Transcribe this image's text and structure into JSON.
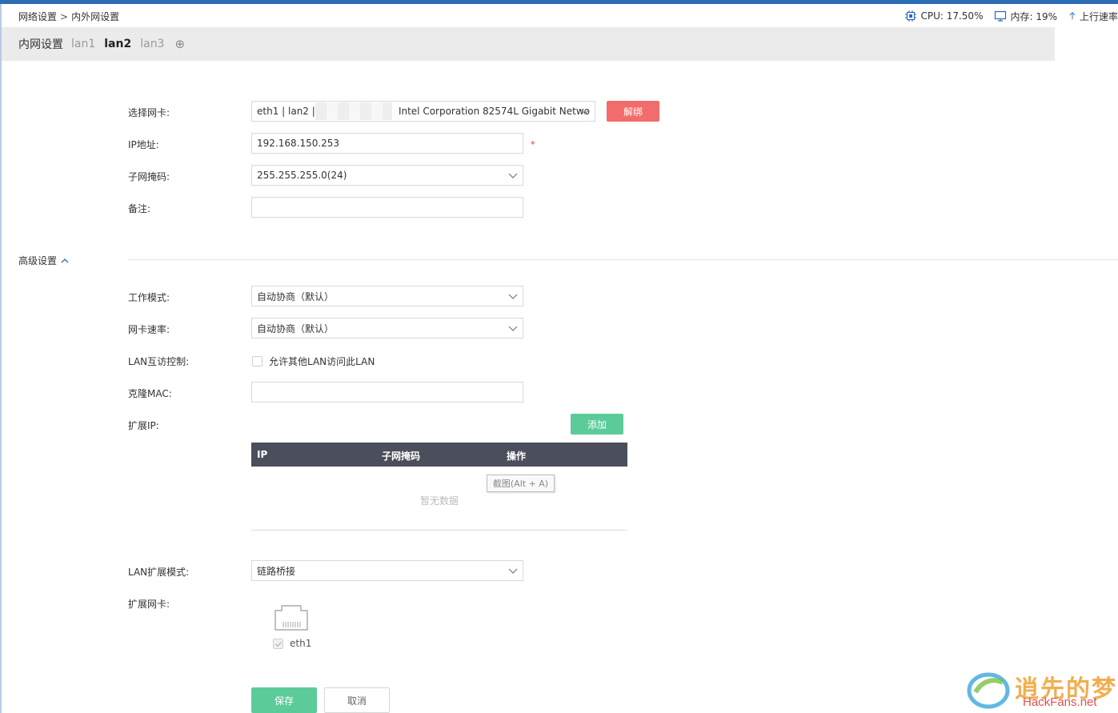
{
  "breadcrumb": {
    "parent": "网络设置",
    "separator": ">",
    "current": "内外网设置"
  },
  "status": {
    "cpu": "CPU: 17.50%",
    "memory": "内存: 19%",
    "upload": "上行速率"
  },
  "tabs": {
    "section": "内网设置",
    "items": [
      "lan1",
      "lan2",
      "lan3"
    ],
    "active": "lan2",
    "add": "⊕"
  },
  "form": {
    "nic_label": "选择网卡:",
    "nic_value_prefix": "eth1 | lan2 | (",
    "nic_value_suffix": "Intel Corporation 82574L Gigabit Netwo",
    "unbind_label": "解绑",
    "ip_label": "IP地址:",
    "ip_value": "192.168.150.253",
    "required_mark": "*",
    "mask_label": "子网掩码:",
    "mask_value": "255.255.255.0(24)",
    "note_label": "备注:",
    "note_value": ""
  },
  "advanced": {
    "toggle_label": "高级设置",
    "work_mode_label": "工作模式:",
    "work_mode_value": "自动协商（默认）",
    "speed_label": "网卡速率:",
    "speed_value": "自动协商（默认）",
    "lan_access_label": "LAN互访控制:",
    "lan_access_text": "允许其他LAN访问此LAN",
    "clone_mac_label": "克隆MAC:",
    "clone_mac_value": "",
    "ext_ip_label": "扩展IP:",
    "add_label": "添加",
    "table_headers": [
      "IP",
      "子网掩码",
      "操作"
    ],
    "empty_text": "暂无数据",
    "tooltip": "截图(Alt + A)",
    "ext_mode_label": "LAN扩展模式:",
    "ext_mode_value": "链路桥接",
    "ext_nic_label": "扩展网卡:",
    "ext_nic_port": "eth1"
  },
  "actions": {
    "save": "保存",
    "cancel": "取消"
  },
  "watermark": {
    "text": "逍先的梦",
    "sub": "HackFans.net"
  },
  "colors": {
    "topbar": "#2b6cb3",
    "danger": "#f36c6c",
    "success": "#5ccb9a",
    "table_header": "#4b4f5c"
  }
}
